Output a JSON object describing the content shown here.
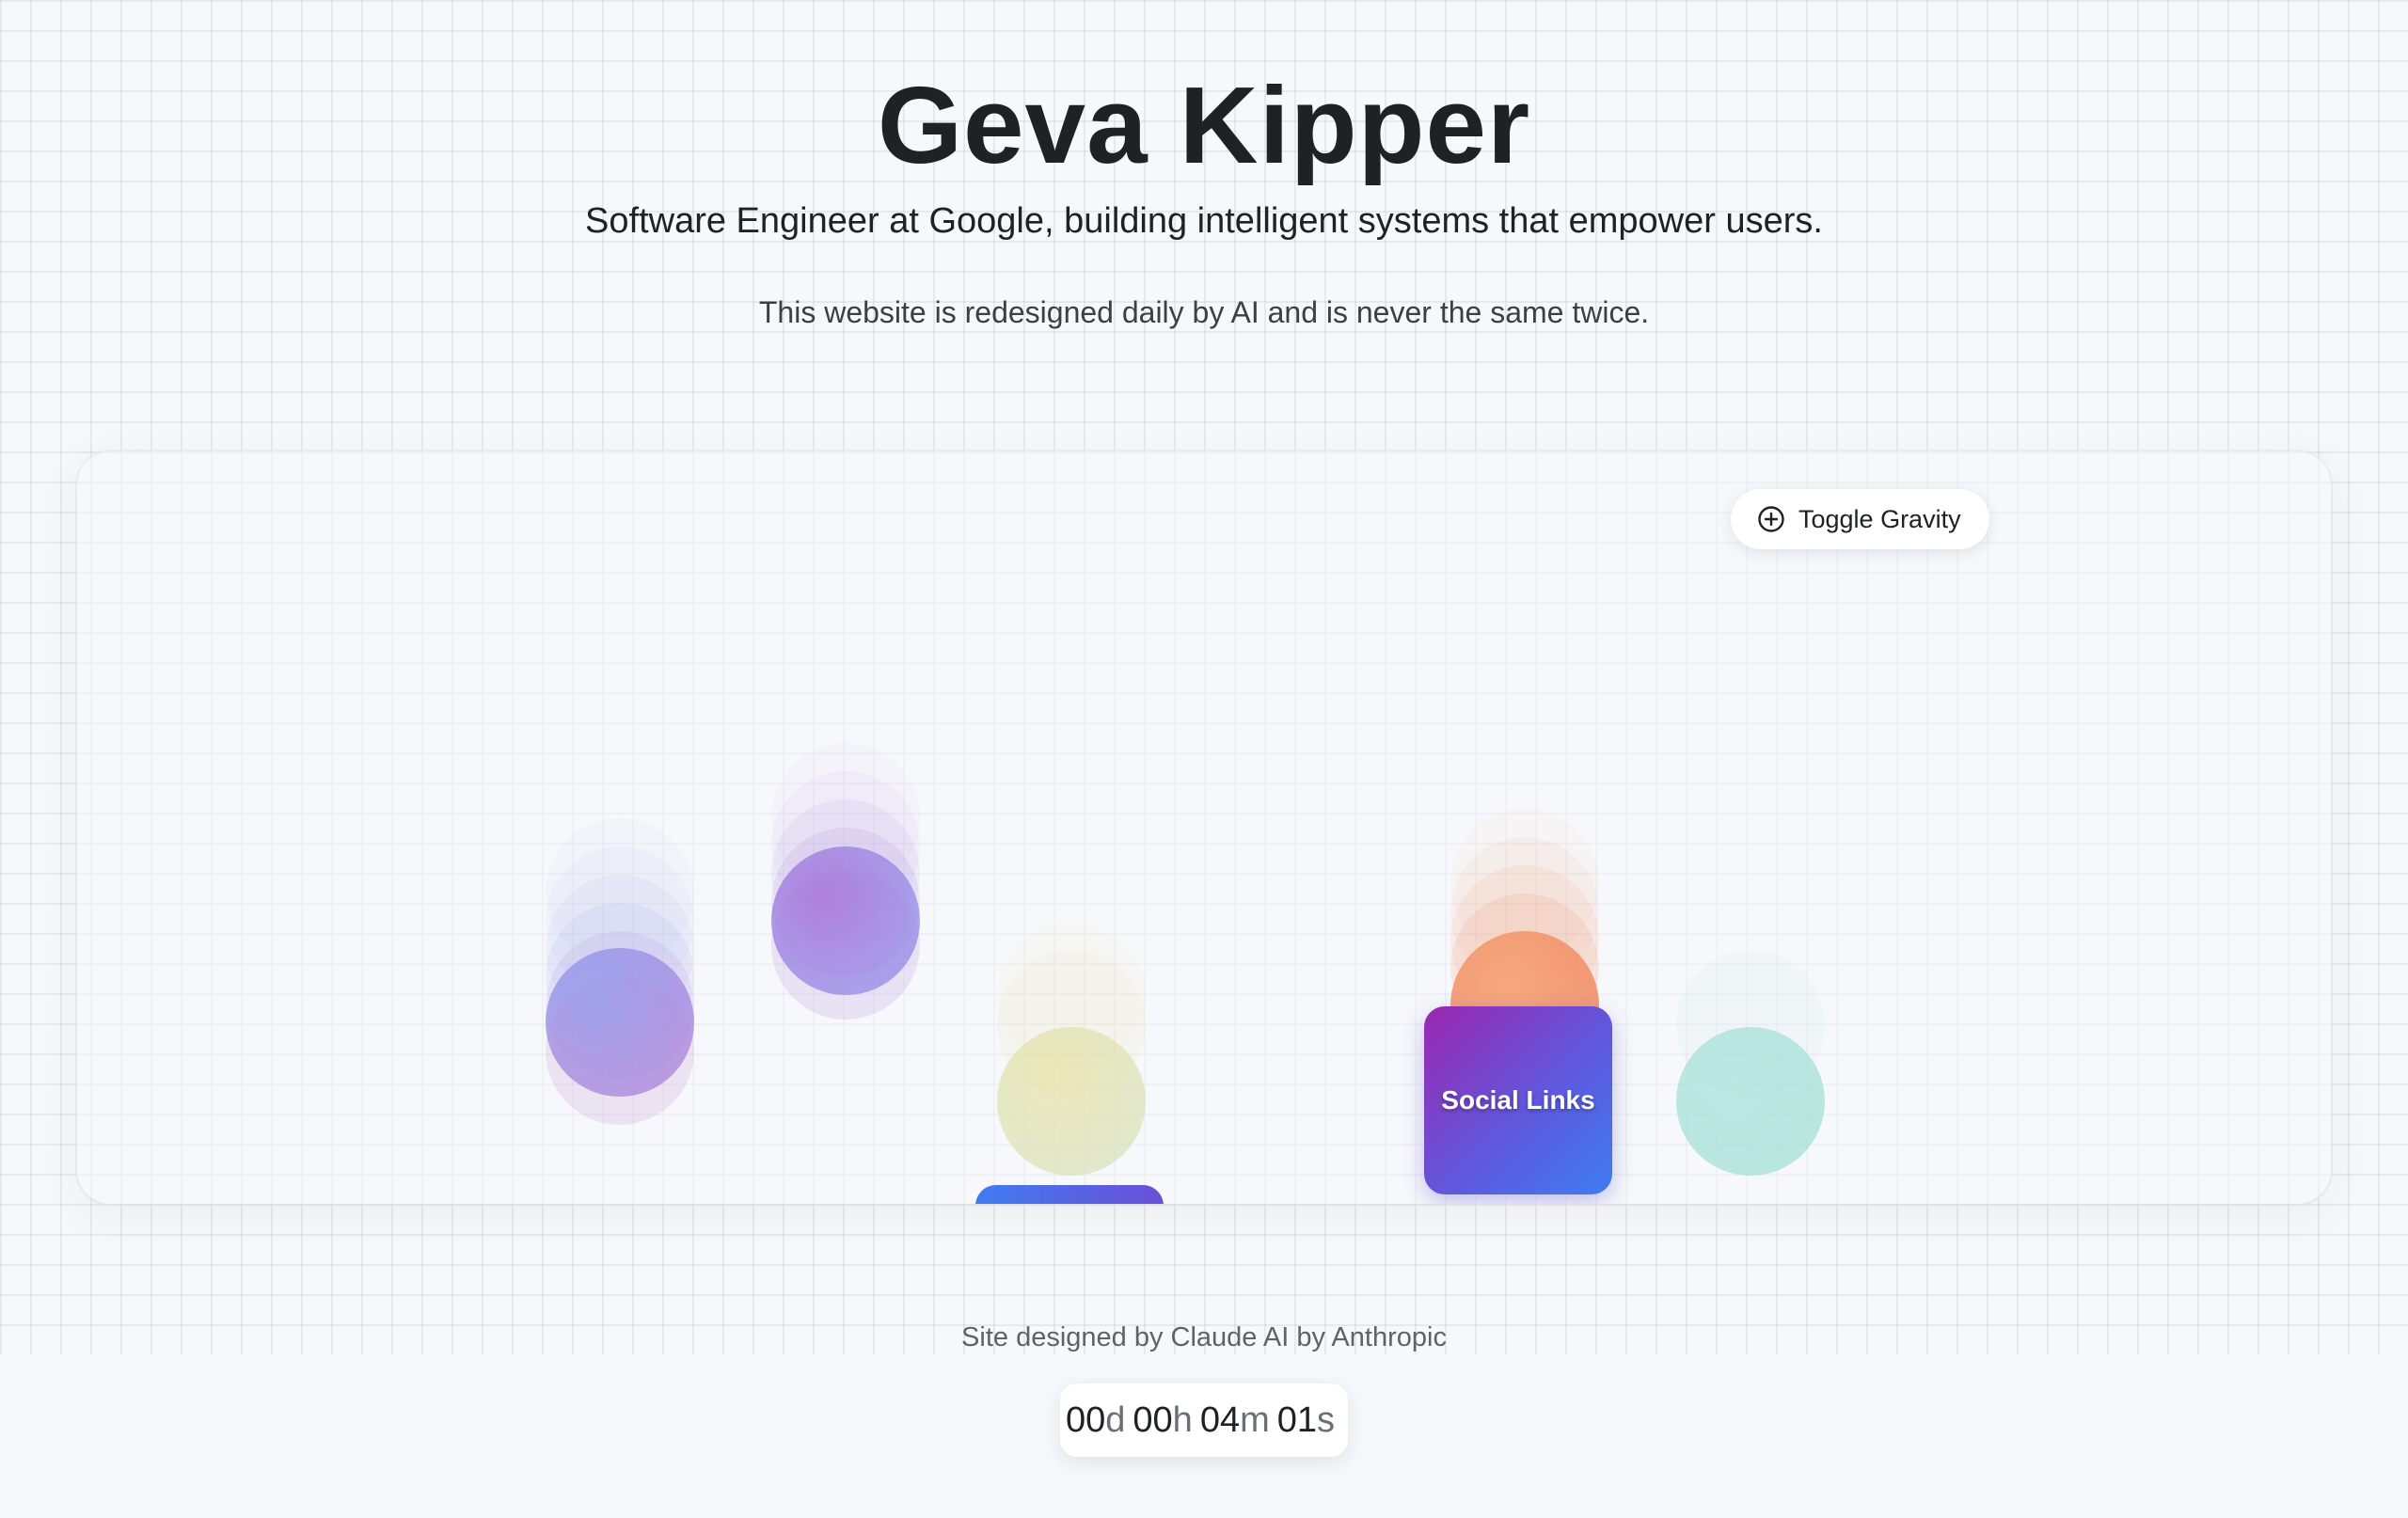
{
  "header": {
    "title": "Geva Kipper",
    "subtitle": "Software Engineer at Google, building intelligent systems that empower users.",
    "tagline": "This website is redesigned daily by AI and is never the same twice."
  },
  "playground": {
    "toggle_button": {
      "label": "Toggle Gravity",
      "icon": "plus-circle-icon"
    },
    "social_card": {
      "label": "Social Links"
    },
    "balls": [
      {
        "name": "ball-blue-purple",
        "colors": [
          "#8f9cf0",
          "#b07ad8"
        ]
      },
      {
        "name": "ball-purple-blue",
        "colors": [
          "#a870d8",
          "#8f9cf0"
        ]
      },
      {
        "name": "ball-yellow",
        "colors": [
          "#e6e09a",
          "#cfe0b0"
        ]
      },
      {
        "name": "ball-orange",
        "colors": [
          "#f5a070",
          "#f07a55"
        ]
      },
      {
        "name": "ball-teal",
        "colors": [
          "#9fe0d6",
          "#bfe8e4"
        ]
      }
    ]
  },
  "footer": {
    "credit": "Site designed by Claude AI by Anthropic",
    "timer": {
      "days_value": "00",
      "days_unit": "d",
      "hours_value": "00",
      "hours_unit": "h",
      "minutes_value": "04",
      "minutes_unit": "m",
      "seconds_value": "01",
      "seconds_unit": "s"
    }
  },
  "colors": {
    "background": "#f7f8fb",
    "text": "#202124",
    "muted": "#5f6368",
    "card_gradient_start": "#9c27b0",
    "card_gradient_end": "#3f7cf0"
  }
}
